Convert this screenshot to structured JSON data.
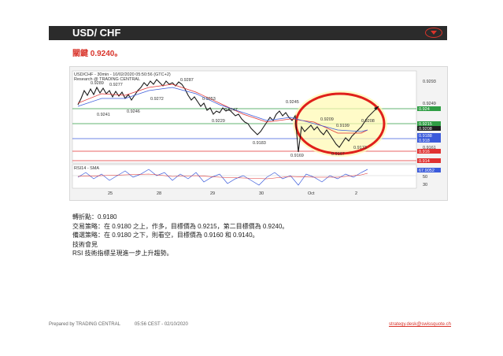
{
  "header": {
    "title": "USD/ CHF",
    "menu_icon": "chevron-down-circle-icon",
    "accent": "#d9342b",
    "bar_color": "#2b2b2b"
  },
  "subtitle": "關鍵 0.9240。",
  "chart": {
    "header_line1": "USD/CHF - 30min - 10/02/2020 05:50:56 (GTC+2)",
    "header_line2": "Research @ TRADING CENTRAL",
    "price_scale": [
      "0.9293",
      "0.9249",
      "0.9208",
      "0.9161"
    ],
    "level_tags": [
      {
        "label": "0.924",
        "color": "#2f9e44"
      },
      {
        "label": "0.9215",
        "color": "#2f9e44"
      },
      {
        "label": "0.9208",
        "color": "#1f1f1f"
      },
      {
        "label": "0.9188",
        "color": "#3b5bdb"
      },
      {
        "label": "0.918",
        "color": "#3b5bdb"
      },
      {
        "label": "0.916",
        "color": "#e03131"
      },
      {
        "label": "0.914",
        "color": "#e03131"
      }
    ],
    "swing_labels": [
      "0.9289",
      "0.9277",
      "0.9287",
      "0.9272",
      "0.9241",
      "0.9246",
      "0.9253",
      "0.9247",
      "0.9229",
      "0.9245",
      "0.9183",
      "0.9169",
      "0.9209",
      "0.9199",
      "0.9208",
      "0.9173",
      "0.9167"
    ],
    "rsi_label": "RSI14 - SMA",
    "rsi_scale": [
      "67.9052",
      "50",
      "30"
    ],
    "x_ticks": [
      "25",
      "28",
      "29",
      "30",
      "Oct",
      "2"
    ]
  },
  "analysis": {
    "pivot": "轉折點：0.9180",
    "strategy": "交易策略：在 0.9180 之上，作多，目標價為 0.9215，第二目標價為 0.9240。",
    "alternative": "備選策略：在 0.9180 之下，則看空，目標價為 0.9160 和 0.9140。",
    "comment_title": "技術會見",
    "comment": "RSI 技術指標呈現進一步上升趨勢。"
  },
  "footer": {
    "prepared": "Prepared by TRADING CENTRAL",
    "timestamp": "05:56 CEST - 02/10/2020",
    "email": "strategy.desk@swissquote.ch"
  }
}
